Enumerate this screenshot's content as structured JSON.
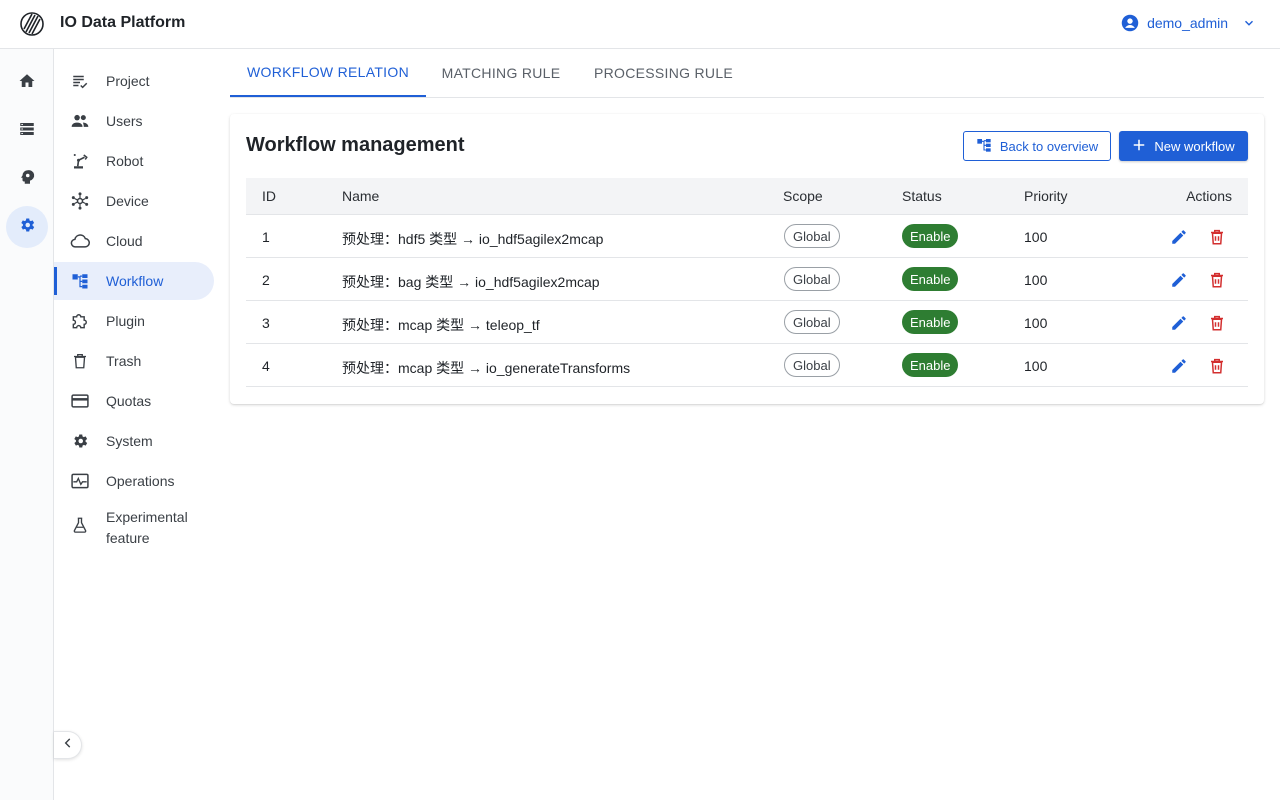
{
  "app": {
    "title": "IO Data Platform",
    "logo_icon": "logo-stripes-icon"
  },
  "user": {
    "name": "demo_admin"
  },
  "rail": [
    {
      "name": "home",
      "icon": "home-icon"
    },
    {
      "name": "data",
      "icon": "storage-icon"
    },
    {
      "name": "ai",
      "icon": "psychology-icon"
    },
    {
      "name": "settings",
      "icon": "gear-icon",
      "active": true
    }
  ],
  "nav": {
    "items": [
      {
        "label": "Project",
        "icon": "checklist-icon"
      },
      {
        "label": "Users",
        "icon": "people-icon"
      },
      {
        "label": "Robot",
        "icon": "robot-arm-icon"
      },
      {
        "label": "Device",
        "icon": "hub-icon"
      },
      {
        "label": "Cloud",
        "icon": "cloud-icon"
      },
      {
        "label": "Workflow",
        "icon": "workflow-icon",
        "active": true
      },
      {
        "label": "Plugin",
        "icon": "puzzle-icon"
      },
      {
        "label": "Trash",
        "icon": "trash-icon"
      },
      {
        "label": "Quotas",
        "icon": "card-icon"
      },
      {
        "label": "System",
        "icon": "gear-icon"
      },
      {
        "label": "Operations",
        "icon": "monitor-icon"
      },
      {
        "label": "Experimental feature",
        "icon": "flask-icon"
      }
    ]
  },
  "tabs": [
    {
      "label": "WORKFLOW RELATION",
      "active": true
    },
    {
      "label": "MATCHING RULE"
    },
    {
      "label": "PROCESSING RULE"
    }
  ],
  "card": {
    "title": "Workflow management",
    "back_label": "Back to overview",
    "new_label": "New workflow"
  },
  "table": {
    "headers": {
      "id": "ID",
      "name": "Name",
      "scope": "Scope",
      "status": "Status",
      "priority": "Priority",
      "actions": "Actions"
    },
    "rows": [
      {
        "id": "1",
        "name": "预处理：hdf5 类型 → io_hdf5agilex2mcap",
        "scope": "Global",
        "status": "Enable",
        "priority": "100"
      },
      {
        "id": "2",
        "name": "预处理：bag 类型 → io_hdf5agilex2mcap",
        "scope": "Global",
        "status": "Enable",
        "priority": "100"
      },
      {
        "id": "3",
        "name": "预处理：mcap 类型 → teleop_tf",
        "scope": "Global",
        "status": "Enable",
        "priority": "100"
      },
      {
        "id": "4",
        "name": "预处理：mcap 类型 → io_generateTransforms",
        "scope": "Global",
        "status": "Enable",
        "priority": "100"
      }
    ]
  },
  "colors": {
    "accent": "#1f5fd6",
    "success": "#2e7d32",
    "danger": "#d32f2f"
  }
}
